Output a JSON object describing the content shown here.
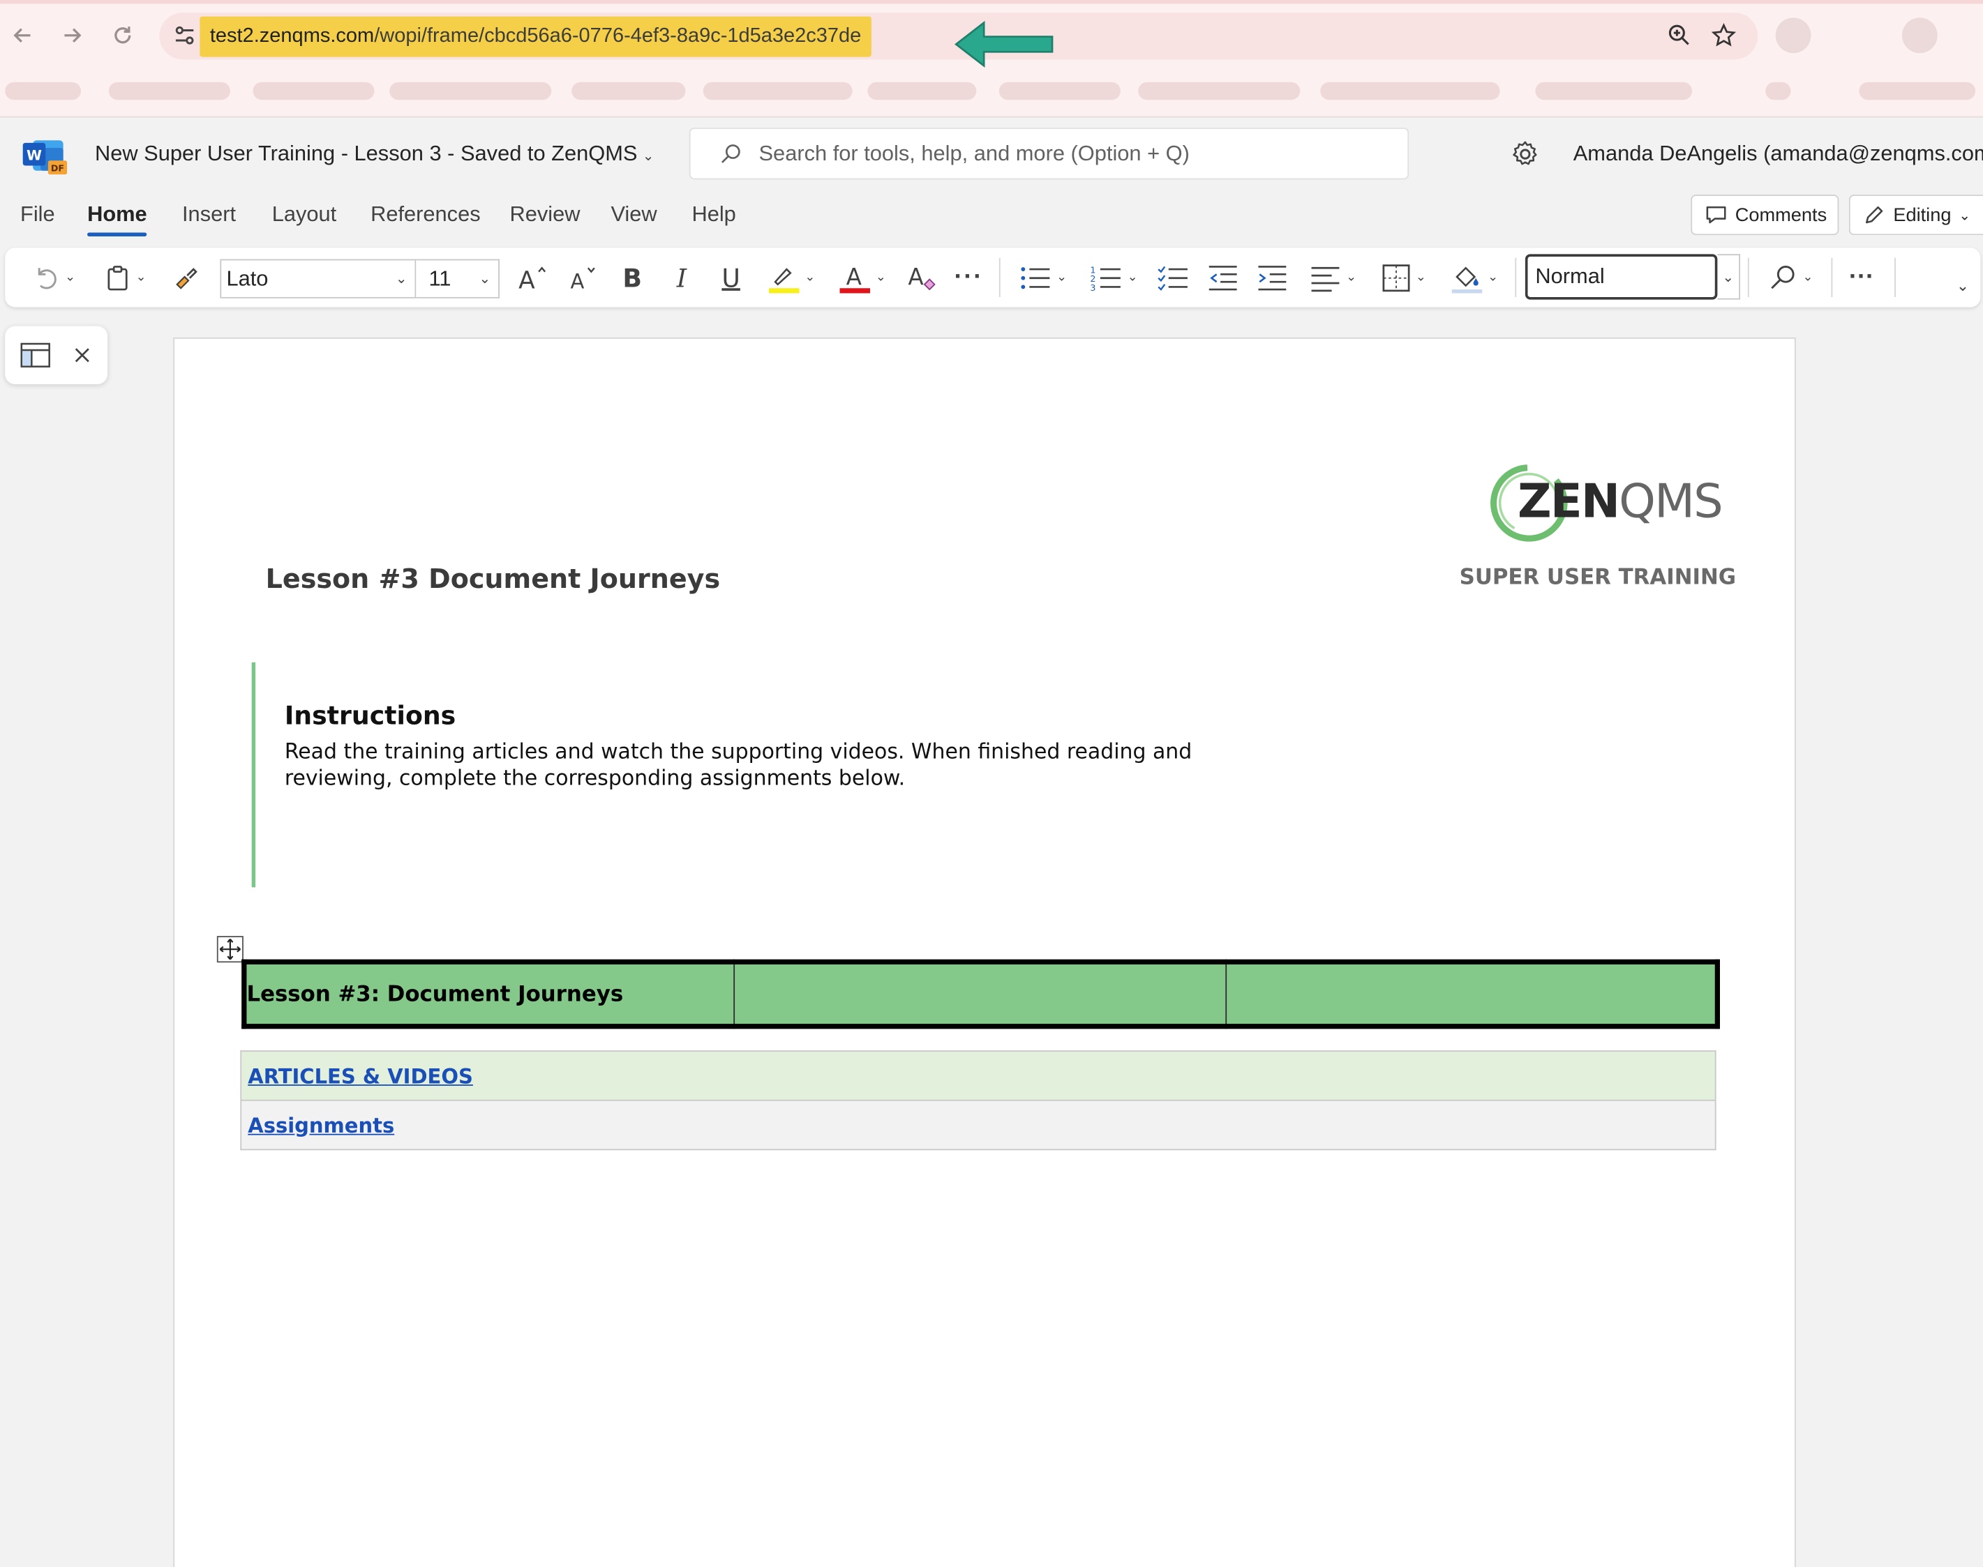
{
  "browser": {
    "url_domain": "test2.zenqms.com",
    "url_path": "/wopi/frame/cbcd56a6-0776-4ef3-8a9c-1d5a3e2c37de",
    "highlight_color": "#f5cf47",
    "arrow_color": "#2aa88e",
    "icons": [
      "back-icon",
      "forward-icon",
      "reload-icon",
      "site-settings-icon",
      "zoom-icon",
      "bookmark-star-icon"
    ]
  },
  "titlebar": {
    "doc_title": "New Super User Training - Lesson 3  -  Saved to ZenQMS",
    "search_placeholder": "Search for tools, help, and more (Option + Q)",
    "account_name": "Amanda DeAngelis (amanda@zenqms.com"
  },
  "tabs": [
    {
      "label": "File",
      "active": false
    },
    {
      "label": "Home",
      "active": true
    },
    {
      "label": "Insert",
      "active": false
    },
    {
      "label": "Layout",
      "active": false
    },
    {
      "label": "References",
      "active": false
    },
    {
      "label": "Review",
      "active": false
    },
    {
      "label": "View",
      "active": false
    },
    {
      "label": "Help",
      "active": false
    }
  ],
  "actions": {
    "comments_label": "Comments",
    "editing_label": "Editing"
  },
  "ribbon": {
    "font_name": "Lato",
    "font_size": "11",
    "style_name": "Normal",
    "highlight_color": "#f7ef1e",
    "font_color": "#e0151b"
  },
  "document": {
    "logo_zen": "ZEN",
    "logo_qms": "QMS",
    "tagline": "SUPER USER TRAINING",
    "lesson_title": "Lesson #3 Document Journeys",
    "instructions_heading": "Instructions",
    "instructions_body": "Read the training articles and watch the supporting videos. When finished reading and reviewing, complete the corresponding assignments below.",
    "header_table": {
      "cells": [
        "Lesson #3: Document Journeys",
        "",
        ""
      ],
      "color": "#84c98a"
    },
    "link_rows": [
      {
        "label": "ARTICLES & VIDEOS",
        "bg": "#e3f0dc"
      },
      {
        "label": "Assignments",
        "bg": "#f2f2f2"
      }
    ],
    "accent_color": "#7cc68a"
  }
}
